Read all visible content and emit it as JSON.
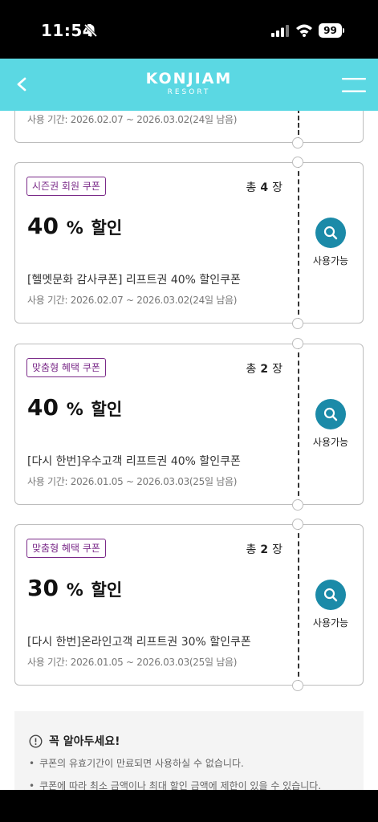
{
  "status": {
    "time": "11:54",
    "battery": "99"
  },
  "header": {
    "logo_main": "KONJIAM",
    "logo_sub": "RESORT"
  },
  "partial_coupon": {
    "period": "사용 기간: 2026.02.07 ~ 2026.03.02(24일 남음)"
  },
  "coupons": [
    {
      "badge": "시즌권 회원 쿠폰",
      "count_prefix": "총",
      "count": "4",
      "count_suffix": "장",
      "discount_value": "40",
      "discount_pct": "%",
      "discount_label": "할인",
      "name": "[헬멧문화 감사쿠폰] 리프트권 40% 할인쿠폰",
      "period": "사용 기간: 2026.02.07 ~ 2026.03.02(24일 남음)",
      "action": "사용가능"
    },
    {
      "badge": "맞춤형 혜택 쿠폰",
      "count_prefix": "총",
      "count": "2",
      "count_suffix": "장",
      "discount_value": "40",
      "discount_pct": "%",
      "discount_label": "할인",
      "name": "[다시 한번]우수고객 리프트권 40% 할인쿠폰",
      "period": "사용 기간: 2026.01.05 ~ 2026.03.03(25일 남음)",
      "action": "사용가능"
    },
    {
      "badge": "맞춤형 혜택 쿠폰",
      "count_prefix": "총",
      "count": "2",
      "count_suffix": "장",
      "discount_value": "30",
      "discount_pct": "%",
      "discount_label": "할인",
      "name": "[다시 한번]온라인고객 리프트권 30% 할인쿠폰",
      "period": "사용 기간: 2026.01.05 ~ 2026.03.03(25일 남음)",
      "action": "사용가능"
    }
  ],
  "notice": {
    "title": "꼭 알아두세요!",
    "items": [
      "쿠폰의 유효기간이 만료되면 사용하실 수 없습니다.",
      "쿠폰에 따라 최소 금액이나 최대 할인 금액에 제한이 있을 수 있습니다."
    ]
  },
  "colors": {
    "header_bg": "#5bd8e3",
    "badge": "#7a2a88",
    "action_circle": "#1b8aa8"
  },
  "icons": {
    "back": "chevron-left-icon",
    "menu": "hamburger-menu-icon",
    "search": "search-icon",
    "notice": "info-circle-icon",
    "bell": "bell-slash-icon"
  }
}
